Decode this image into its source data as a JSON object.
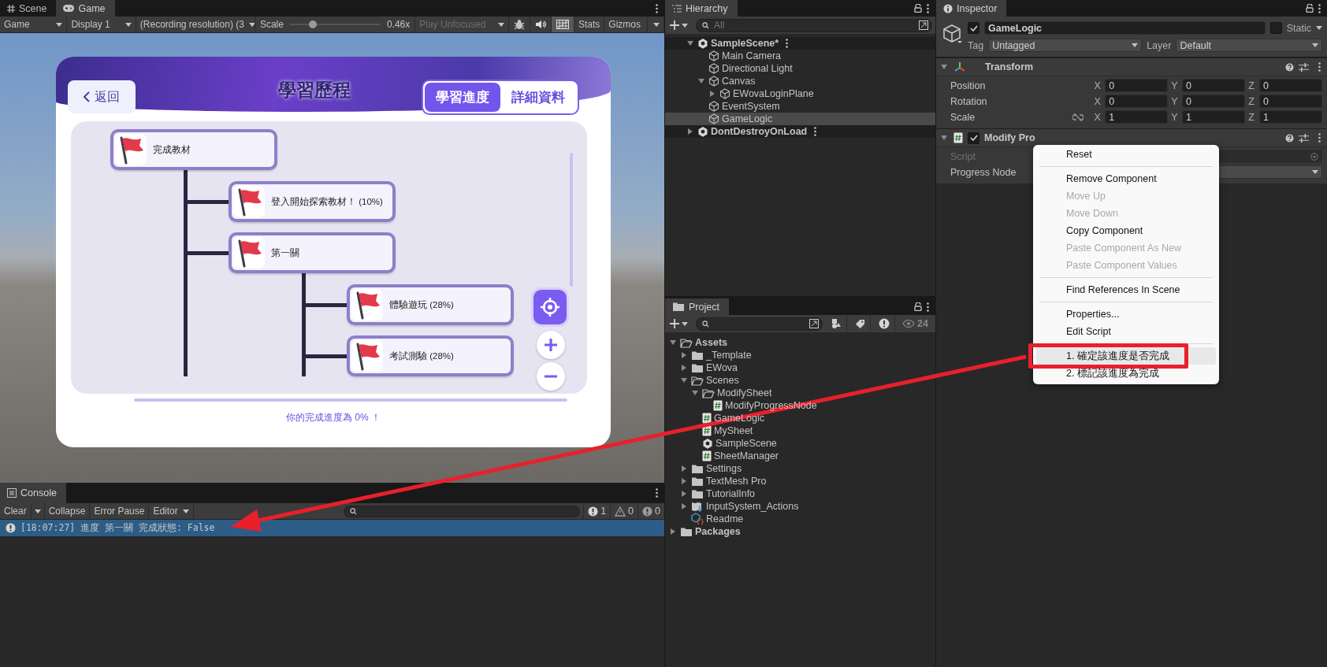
{
  "game_view": {
    "tabs": [
      {
        "label": "Scene",
        "kind": "scene",
        "selected": false
      },
      {
        "label": "Game",
        "kind": "game",
        "selected": true
      }
    ],
    "toolbar": {
      "view_dropdown": "Game",
      "display_dropdown": "Display 1",
      "resolution_dropdown": "(Recording resolution) (3",
      "scale_label": "Scale",
      "scale_slider": {
        "level": 0.25
      },
      "scale_value": "0.46x",
      "play_mode_dropdown": {
        "label": "Play Unfocused",
        "disabled": true
      },
      "grid_toggle": {
        "on": true
      },
      "stats_button": "Stats",
      "gizmos_button": "Gizmos"
    },
    "app": {
      "back_button": "返回",
      "title": "學習歷程",
      "tabs": [
        {
          "label": "學習進度",
          "selected": true
        },
        {
          "label": "詳細資料",
          "selected": false
        }
      ],
      "progress_tree": [
        {
          "label": "完成教材",
          "children": [
            {
              "label": "登入開始探索教材！ (10%)"
            },
            {
              "label": "第一關",
              "children": [
                {
                  "label": "體驗遊玩 (28%)"
                },
                {
                  "label": "考試測驗 (28%)"
                }
              ]
            }
          ]
        }
      ],
      "footer": "你的完成進度為 0% ！"
    }
  },
  "hierarchy": {
    "tab": "Hierarchy",
    "search": {
      "placeholder": "All"
    },
    "items": [
      {
        "label": "SampleScene*",
        "kind": "scene",
        "expanded": true,
        "selected": false,
        "children": [
          {
            "label": "Main Camera",
            "kind": "object",
            "selected": false
          },
          {
            "label": "Directional Light",
            "kind": "object",
            "selected": false
          },
          {
            "label": "Canvas",
            "kind": "object",
            "expanded": true,
            "selected": false,
            "children": [
              {
                "label": "EWovaLoginPlane",
                "kind": "object",
                "expanded": false,
                "selected": false
              }
            ]
          },
          {
            "label": "EventSystem",
            "kind": "object",
            "selected": false
          },
          {
            "label": "GameLogic",
            "kind": "object",
            "selected": true
          }
        ]
      },
      {
        "label": "DontDestroyOnLoad",
        "kind": "scene",
        "expanded": false,
        "selected": false
      }
    ]
  },
  "project": {
    "tab": "Project",
    "hidden_count": "24",
    "tree": [
      {
        "label": "Assets",
        "kind": "folder",
        "expanded": true,
        "children": [
          {
            "label": "_Template",
            "kind": "folder",
            "expanded": false
          },
          {
            "label": "EWova",
            "kind": "folder",
            "expanded": false
          },
          {
            "label": "Scenes",
            "kind": "folder",
            "expanded": true,
            "children": [
              {
                "label": "ModifySheet",
                "kind": "folder",
                "expanded": true,
                "children": [
                  {
                    "label": "ModifyProgressNode",
                    "kind": "script"
                  }
                ]
              },
              {
                "label": "GameLogic",
                "kind": "script"
              },
              {
                "label": "MySheet",
                "kind": "script"
              },
              {
                "label": "SampleScene",
                "kind": "scene"
              },
              {
                "label": "SheetManager",
                "kind": "script"
              }
            ]
          },
          {
            "label": "Settings",
            "kind": "folder",
            "expanded": false
          },
          {
            "label": "TextMesh Pro",
            "kind": "folder",
            "expanded": false
          },
          {
            "label": "TutorialInfo",
            "kind": "folder",
            "expanded": false
          },
          {
            "label": "InputSystem_Actions",
            "kind": "input_actions",
            "expanded": false
          },
          {
            "label": "Readme",
            "kind": "readme"
          }
        ]
      },
      {
        "label": "Packages",
        "kind": "folder",
        "expanded": false
      }
    ]
  },
  "inspector": {
    "tab": "Inspector",
    "object": {
      "active": true,
      "name": "GameLogic",
      "static": false,
      "static_label": "Static",
      "tag_label": "Tag",
      "tag": "Untagged",
      "layer_label": "Layer",
      "layer": "Default"
    },
    "components": [
      {
        "kind": "transform",
        "title": "Transform",
        "expanded": true,
        "rows": [
          {
            "label": "Position",
            "values": [
              {
                "axis": "X",
                "value": "0"
              },
              {
                "axis": "Y",
                "value": "0"
              },
              {
                "axis": "Z",
                "value": "0"
              }
            ]
          },
          {
            "label": "Rotation",
            "values": [
              {
                "axis": "X",
                "value": "0"
              },
              {
                "axis": "Y",
                "value": "0"
              },
              {
                "axis": "Z",
                "value": "0"
              }
            ]
          },
          {
            "label": "Scale",
            "lock": false,
            "values": [
              {
                "axis": "X",
                "value": "1"
              },
              {
                "axis": "Y",
                "value": "1"
              },
              {
                "axis": "Z",
                "value": "1"
              }
            ]
          }
        ]
      },
      {
        "kind": "script",
        "title": "Modify Pro",
        "enabled": true,
        "expanded": true,
        "fields": [
          {
            "label": "Script",
            "kind": "object",
            "disabled": true
          },
          {
            "label": "Progress Node",
            "kind": "dropdown",
            "disabled": false
          }
        ]
      }
    ]
  },
  "context_menu": {
    "groups": [
      [
        {
          "label": "Reset",
          "disabled": false,
          "selected": false
        }
      ],
      [
        {
          "label": "Remove Component",
          "disabled": false,
          "selected": false
        },
        {
          "label": "Move Up",
          "disabled": true,
          "selected": false
        },
        {
          "label": "Move Down",
          "disabled": true,
          "selected": false
        },
        {
          "label": "Copy Component",
          "disabled": false,
          "selected": false
        },
        {
          "label": "Paste Component As New",
          "disabled": true,
          "selected": false
        },
        {
          "label": "Paste Component Values",
          "disabled": true,
          "selected": false
        }
      ],
      [
        {
          "label": "Find References In Scene",
          "disabled": false,
          "selected": false
        }
      ],
      [
        {
          "label": "Properties...",
          "disabled": false,
          "selected": false
        },
        {
          "label": "Edit Script",
          "disabled": false,
          "selected": false
        }
      ],
      [
        {
          "label": "1. 確定該進度是否完成",
          "disabled": false,
          "selected": true
        },
        {
          "label": "2. 標記該進度為完成",
          "disabled": false,
          "selected": false
        }
      ]
    ]
  },
  "console": {
    "tab": "Console",
    "toolbar": {
      "clear": "Clear",
      "collapse": "Collapse",
      "error_pause": "Error Pause",
      "editor": "Editor"
    },
    "counts": {
      "info": "1",
      "warning": "0",
      "error": "0"
    },
    "entries": [
      {
        "text": "[18:07:27] 進度 第一關 完成狀態: False",
        "selected": true
      }
    ]
  }
}
